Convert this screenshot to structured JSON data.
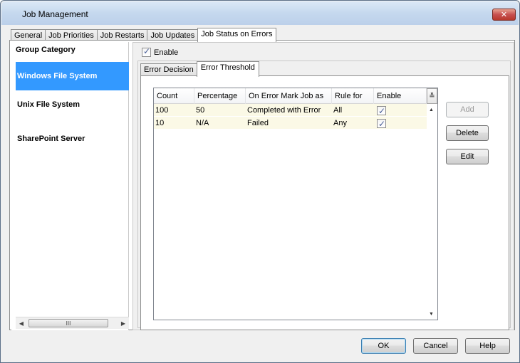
{
  "window": {
    "title": "Job Management",
    "close_label": "✕"
  },
  "tabs": [
    {
      "label": "General"
    },
    {
      "label": "Job Priorities"
    },
    {
      "label": "Job Restarts"
    },
    {
      "label": "Job Updates"
    },
    {
      "label": "Job Status on Errors",
      "active": true
    }
  ],
  "category": {
    "header": "Group Category",
    "items": [
      {
        "label": "Windows File System",
        "selected": true
      },
      {
        "label": "Unix File System"
      },
      {
        "label": "SharePoint Server"
      }
    ],
    "scroll_thumb_grip": "III"
  },
  "enable_label": "Enable",
  "subtabs": [
    {
      "label": "Error Decision"
    },
    {
      "label": "Error Threshold",
      "active": true
    }
  ],
  "grid": {
    "columns": [
      "Count",
      "Percentage",
      "On Error Mark Job as",
      "Rule for",
      "Enable"
    ],
    "rows": [
      {
        "count": "100",
        "percentage": "50",
        "mark_as": "Completed with Error",
        "rule_for": "All",
        "enable": true
      },
      {
        "count": "10",
        "percentage": "N/A",
        "mark_as": "Failed",
        "rule_for": "Any",
        "enable": true
      }
    ]
  },
  "side_buttons": {
    "add": "Add",
    "delete": "Delete",
    "edit": "Edit"
  },
  "footer": {
    "ok": "OK",
    "cancel": "Cancel",
    "help": "Help"
  }
}
